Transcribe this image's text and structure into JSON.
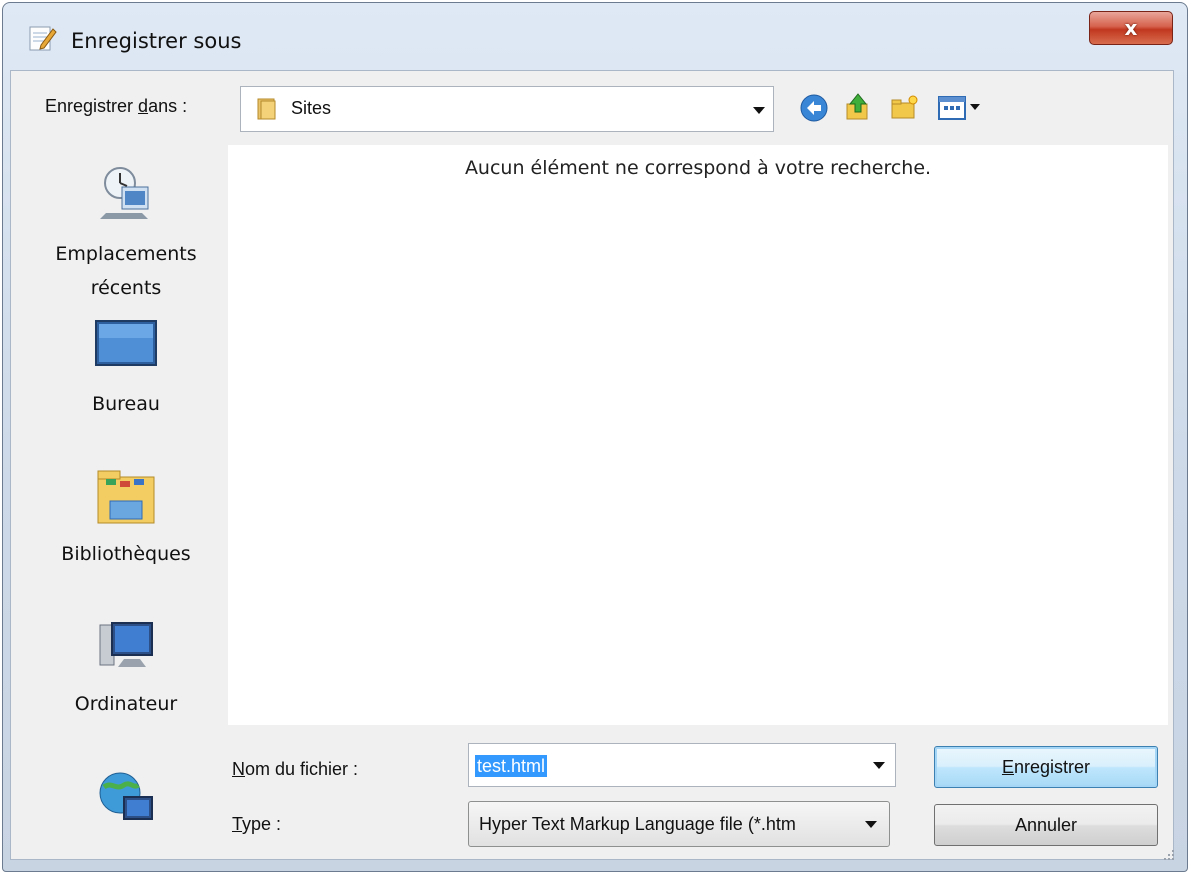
{
  "window": {
    "title": "Enregistrer sous",
    "close_glyph": "x"
  },
  "toolbar": {
    "save_in_label_pre": "Enregistrer ",
    "save_in_label_u": "d",
    "save_in_label_post": "ans :",
    "location": "Sites",
    "icons": [
      "back-icon",
      "up-folder-icon",
      "new-folder-icon",
      "view-menu-icon"
    ]
  },
  "places": [
    {
      "label_line1": "Emplacements",
      "label_line2": "récents",
      "icon": "recent-places-icon"
    },
    {
      "label": "Bureau",
      "icon": "desktop-icon"
    },
    {
      "label": "Bibliothèques",
      "icon": "libraries-icon"
    },
    {
      "label": "Ordinateur",
      "icon": "computer-icon"
    },
    {
      "label": "",
      "icon": "network-icon"
    }
  ],
  "file_list": {
    "empty_message": "Aucun élément ne correspond à votre recherche."
  },
  "form": {
    "filename_label_u": "N",
    "filename_label_rest": "om du fichier :",
    "filename_value": "test.html",
    "type_label_u": "T",
    "type_label_rest": "ype :",
    "type_value": "Hyper Text Markup Language file (*.htm"
  },
  "buttons": {
    "save_u": "E",
    "save_rest": "nregistrer",
    "cancel": "Annuler"
  },
  "colors": {
    "accent": "#3399ff",
    "close": "#c1371f"
  }
}
